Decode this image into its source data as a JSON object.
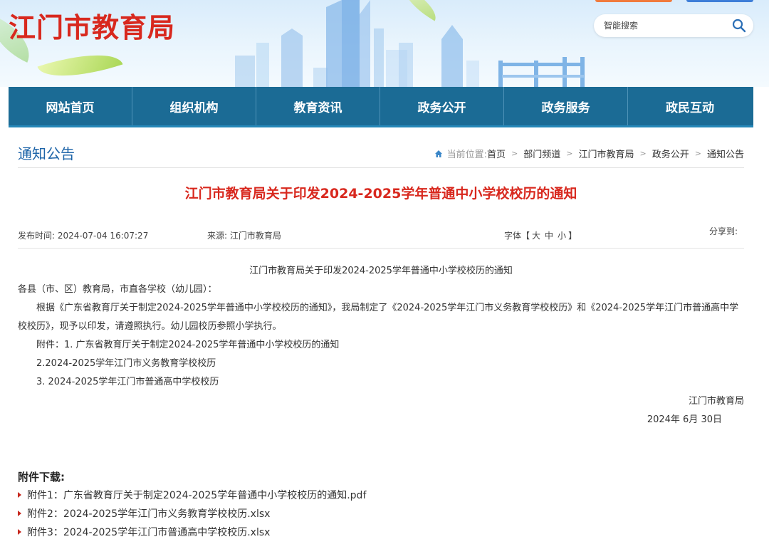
{
  "header": {
    "site_title": "江门市教育局",
    "search_placeholder": "智能搜索"
  },
  "nav": {
    "items": [
      "网站首页",
      "组织机构",
      "教育资讯",
      "政务公开",
      "政务服务",
      "政民互动"
    ]
  },
  "section": {
    "title": "通知公告"
  },
  "breadcrumb": {
    "label": "当前位置:",
    "items": [
      "首页",
      "部门频道",
      "江门市教育局",
      "政务公开",
      "通知公告"
    ],
    "separator": ">"
  },
  "article": {
    "title": "江门市教育局关于印发2024-2025学年普通中小学校校历的通知",
    "publish_label": "发布时间:",
    "publish_time": "2024-07-04 16:07:27",
    "source_label": "来源:",
    "source": "江门市教育局",
    "font_label": "字体【",
    "font_sizes": [
      "大",
      "中",
      "小"
    ],
    "font_label_end": "】",
    "share_label": "分享到:",
    "center_heading": "江门市教育局关于印发2024-2025学年普通中小学校校历的通知",
    "salutation": "各县（市、区）教育局，市直各学校（幼儿园）：",
    "para1_line1": "根据《广东省教育厅关于制定2024-2025学年普通中小学校校历的通知》，我局制定了《2024-2025学年江门市义务教育学校校历》和《2024-2025学年江门市普通高中学",
    "para1_line2": "校校历》，现予以印发，请遵照执行。幼儿园校历参照小学执行。",
    "attach_line1": "附件：1. 广东省教育厅关于制定2024-2025学年普通中小学校校历的通知",
    "attach_line2": "2.2024-2025学年江门市义务教育学校校历",
    "attach_line3": "3. 2024-2025学年江门市普通高中学校校历",
    "signature": "江门市教育局",
    "date": "2024年 6月 30日"
  },
  "downloads": {
    "title": "附件下载:",
    "items": [
      "附件1：广东省教育厅关于制定2024-2025学年普通中小学校校历的通知.pdf",
      "附件2：2024-2025学年江门市义务教育学校校历.xlsx",
      "附件3：2024-2025学年江门市普通高中学校校历.xlsx"
    ]
  },
  "colors": {
    "brand_red": "#d8281e",
    "nav_blue": "#1b6b95",
    "section_blue": "#1d64a8"
  },
  "icons": [
    "search-icon",
    "home-icon",
    "arrow-bullet-icon"
  ]
}
